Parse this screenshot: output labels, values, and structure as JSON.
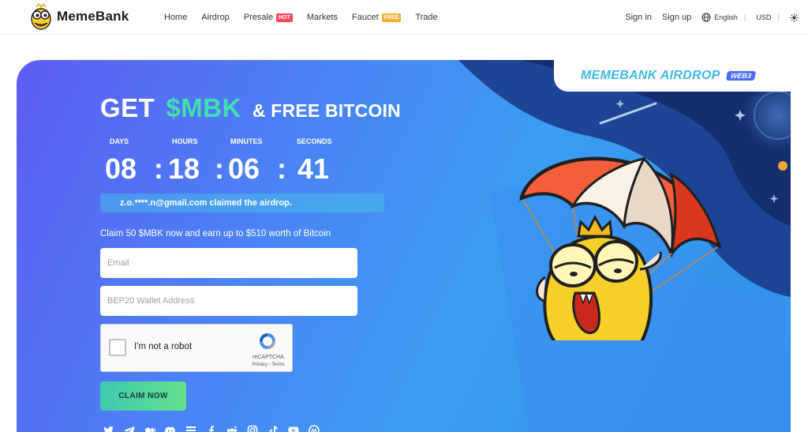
{
  "header": {
    "brand": "MemeBank",
    "nav": [
      {
        "label": "Home"
      },
      {
        "label": "Airdrop"
      },
      {
        "label": "Presale",
        "badge": "HOT"
      },
      {
        "label": "Markets"
      },
      {
        "label": "Faucet",
        "badge": "FREE"
      },
      {
        "label": "Trade"
      }
    ],
    "sign_in": "Sign in",
    "sign_up": "Sign up",
    "language": "English",
    "currency": "USD",
    "separator": "|",
    "theme_icon": "sun-icon",
    "globe_icon": "globe-icon"
  },
  "hero": {
    "tab_title": "MEMEBANK AIRDROP",
    "tab_badge": "WEB3",
    "headline_get": "GET",
    "headline_token": "$MBK",
    "headline_rest": "& FREE BITCOIN",
    "countdown": {
      "labels": {
        "days": "DAYS",
        "hours": "HOURS",
        "minutes": "MINUTES",
        "seconds": "SECONDS"
      },
      "values": {
        "days": "08",
        "hours": "18",
        "minutes": "06",
        "seconds": "41"
      },
      "sep": ":"
    },
    "claimed_notice": "z.o.****.n@gmail.com claimed the airdrop.",
    "subtitle": "Claim 50 $MBK now and earn up to $510 worth of Bitcoin",
    "email_placeholder": "Email",
    "wallet_placeholder": "BEP20 Wallet Address",
    "captcha": {
      "label": "I'm not a robot",
      "brand": "reCAPTCHA",
      "links": "Privacy - Terms"
    },
    "claim_button": "CLAIM NOW",
    "social_icons": [
      "twitter-icon",
      "telegram-icon",
      "medium-icon",
      "discord-icon",
      "docs-icon",
      "facebook-icon",
      "reddit-icon",
      "instagram-icon",
      "tiktok-icon",
      "youtube-icon",
      "coinmarketcap-icon"
    ]
  },
  "colors": {
    "accent_green": "#3fe0b0",
    "hot_badge": "#f04a5e",
    "free_badge": "#f2b23a",
    "tab_title": "#3fb8e4",
    "web3_badge": "#4a6bf2"
  }
}
